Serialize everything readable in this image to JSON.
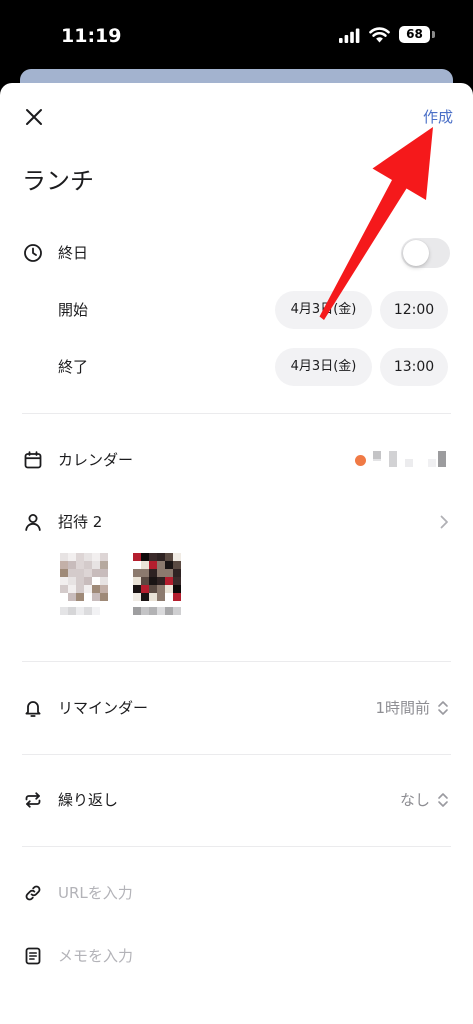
{
  "status_bar": {
    "time": "11:19",
    "battery": "68",
    "icons": [
      "signal-icon",
      "wifi-icon",
      "battery-icon"
    ]
  },
  "header": {
    "close_icon": "close-icon",
    "create_label": "作成"
  },
  "event": {
    "title": "ランチ"
  },
  "all_day": {
    "icon": "clock-icon",
    "label": "終日",
    "enabled": false
  },
  "start": {
    "label": "開始",
    "date": "4月3日(金)",
    "time": "12:00"
  },
  "end": {
    "label": "終了",
    "date": "4月3日(金)",
    "time": "13:00"
  },
  "calendar": {
    "icon": "calendar-icon",
    "label": "カレンダー"
  },
  "invite": {
    "icon": "person-icon",
    "label": "招待 2",
    "chevron_icon": "chevron-right-icon"
  },
  "reminder": {
    "icon": "bell-icon",
    "label": "リマインダー",
    "value": "1時間前",
    "chevron_icon": "up-down-chevron-icon"
  },
  "repeat": {
    "icon": "repeat-icon",
    "label": "繰り返し",
    "value": "なし",
    "chevron_icon": "up-down-chevron-icon"
  },
  "url": {
    "icon": "link-icon",
    "placeholder": "URLを入力"
  },
  "memo": {
    "icon": "memo-icon",
    "placeholder": "メモを入力"
  },
  "colors": {
    "accent": "#4a6fc7",
    "calendar_dot": "#f07a45",
    "annotation_arrow": "#f5191b",
    "background_sheet": "#a3b3cf"
  }
}
